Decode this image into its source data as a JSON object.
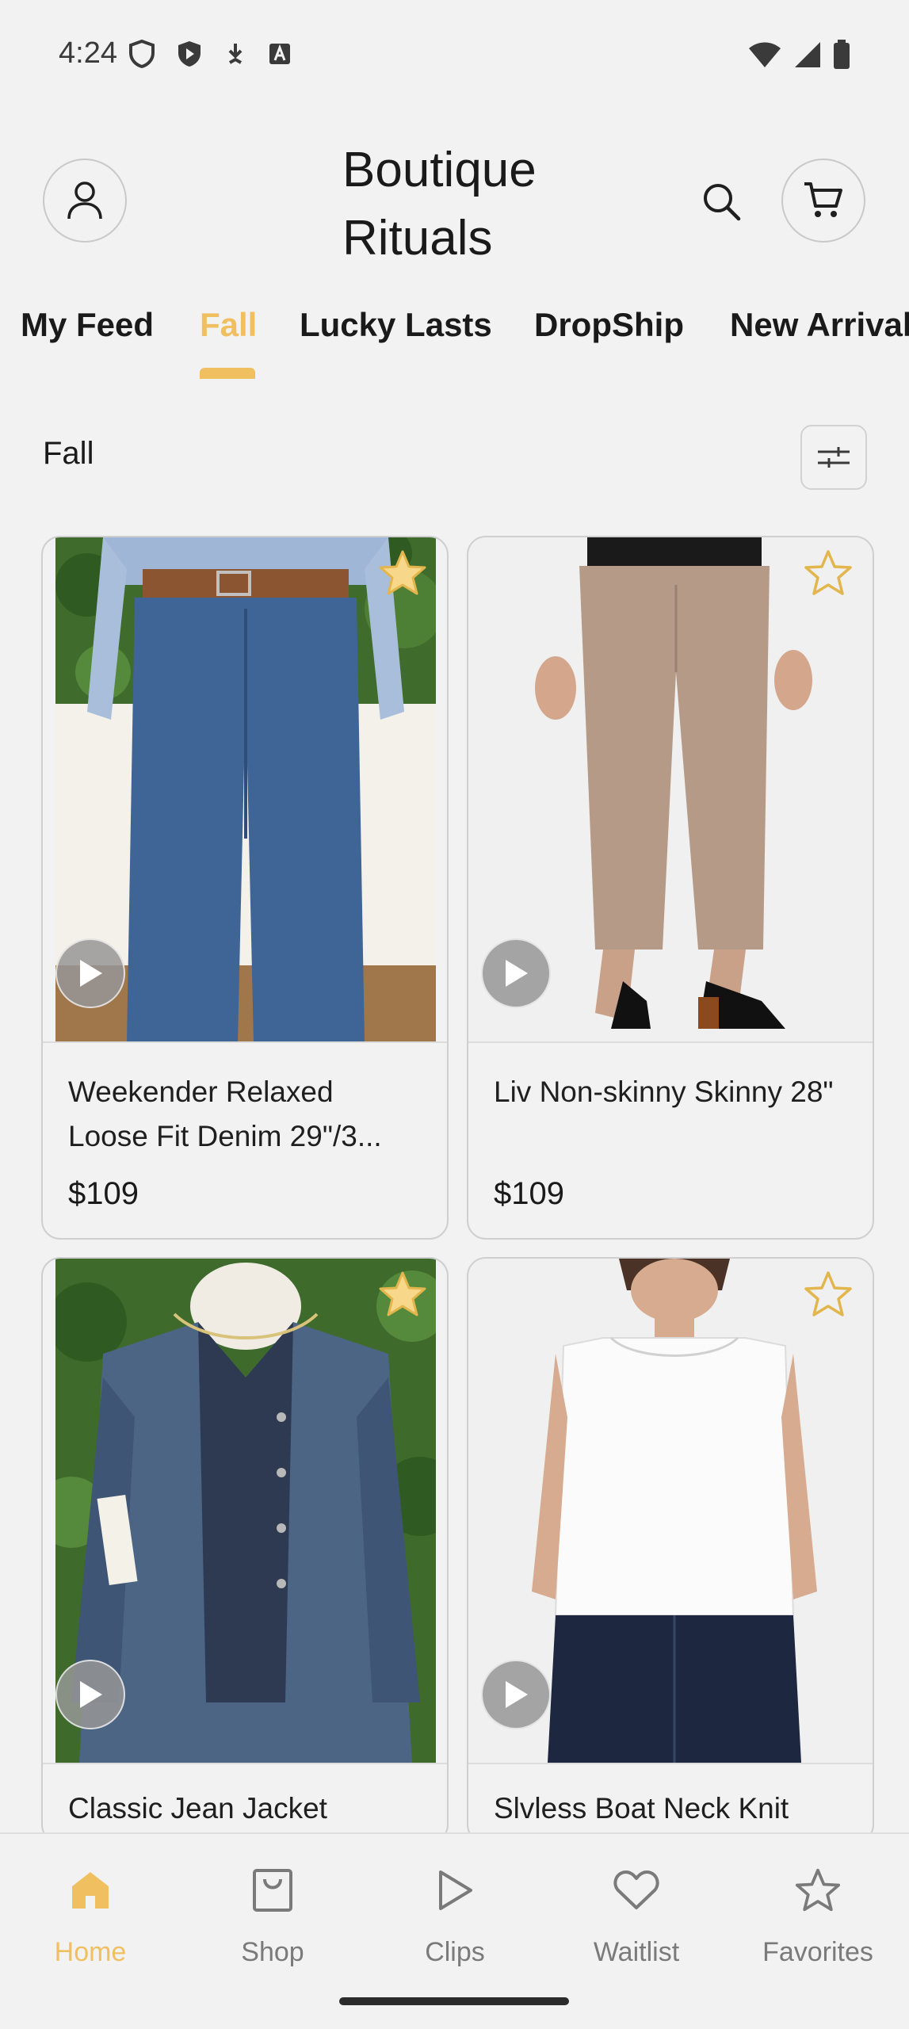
{
  "status_bar": {
    "time": "4:24",
    "left_icons": [
      "shield-icon",
      "play-shield-icon",
      "download-icon",
      "text-a-icon"
    ],
    "right_icons": [
      "wifi-icon",
      "signal-icon",
      "battery-icon"
    ]
  },
  "header": {
    "title_line1": "Boutique",
    "title_line2": "Rituals",
    "icons": [
      "account-icon",
      "search-icon",
      "cart-icon"
    ]
  },
  "tabs": [
    {
      "label": "My Feed",
      "active": false
    },
    {
      "label": "Fall",
      "active": true
    },
    {
      "label": "Lucky Lasts",
      "active": false
    },
    {
      "label": "DropShip",
      "active": false
    },
    {
      "label": "New Arrival",
      "active": false
    }
  ],
  "section": {
    "title": "Fall",
    "filter_icon": "sliders-icon"
  },
  "products": [
    {
      "name": "Weekender Relaxed Loose Fit Denim 29\"/3...",
      "price": "$109"
    },
    {
      "name": "Liv Non-skinny Skinny 28\"",
      "price": "$109"
    },
    {
      "name": "Classic Jean Jacket",
      "price": ""
    },
    {
      "name": "Slvless Boat Neck Knit",
      "price": ""
    }
  ],
  "bottom_nav": [
    {
      "label": "Home",
      "icon": "home-icon",
      "active": true
    },
    {
      "label": "Shop",
      "icon": "bag-icon",
      "active": false
    },
    {
      "label": "Clips",
      "icon": "play-icon",
      "active": false
    },
    {
      "label": "Waitlist",
      "icon": "heart-icon",
      "active": false
    },
    {
      "label": "Favorites",
      "icon": "star-icon",
      "active": false
    }
  ],
  "colors": {
    "accent": "#f0c060",
    "background": "#f2f2f3",
    "text": "#1a1a1a",
    "muted": "#7a7a7a"
  }
}
